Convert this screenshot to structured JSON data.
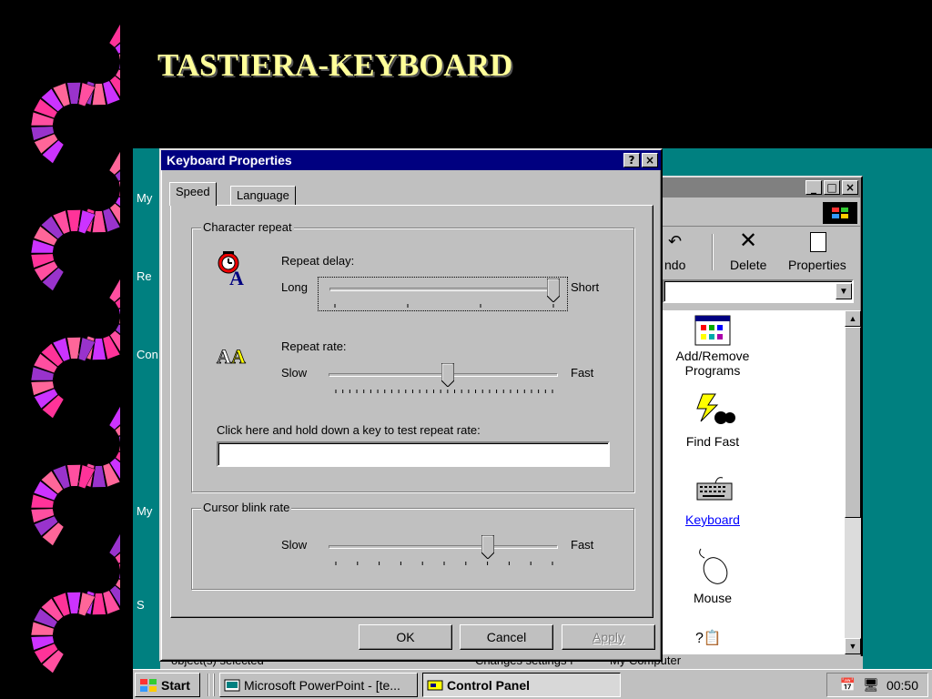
{
  "slide": {
    "title": "TASTIERA-KEYBOARD"
  },
  "desktop": {
    "icons": [
      "My",
      "Re",
      "Con",
      "My",
      "S"
    ]
  },
  "control_panel": {
    "toolbar": {
      "undo": "ndo",
      "delete": "Delete",
      "properties": "Properties"
    },
    "items": {
      "add_remove": "Add/Remove Programs",
      "find_fast": "Find Fast",
      "keyboard": "Keyboard",
      "mouse": "Mouse"
    },
    "status": {
      "left": "object(s) selected",
      "middle": "Changes settings f",
      "right": "My Computer"
    }
  },
  "dialog": {
    "title": "Keyboard Properties",
    "help_button": "?",
    "close_button": "×",
    "tabs": [
      "Speed",
      "Language"
    ],
    "char_repeat_group": "Character repeat",
    "repeat_delay_label": "Repeat delay:",
    "delay_long": "Long",
    "delay_short": "Short",
    "repeat_delay_level": 1.0,
    "repeat_rate_label": "Repeat rate:",
    "rate_slow": "Slow",
    "rate_fast": "Fast",
    "repeat_rate_level": 0.52,
    "test_label": "Click here and hold down a key to test repeat rate:",
    "test_value": "",
    "cursor_group": "Cursor blink rate",
    "blink_slow": "Slow",
    "blink_fast": "Fast",
    "blink_level": 0.7,
    "ok": "OK",
    "cancel": "Cancel",
    "apply": "Apply"
  },
  "taskbar": {
    "start": "Start",
    "powerpoint": "Microsoft PowerPoint - [te...",
    "control_panel": "Control Panel",
    "clock": "00:50"
  },
  "colors": {
    "desktop": "#008080",
    "titlebar": "#000080",
    "slide_title": "#ffff99",
    "chrome": "#c0c0c0"
  }
}
